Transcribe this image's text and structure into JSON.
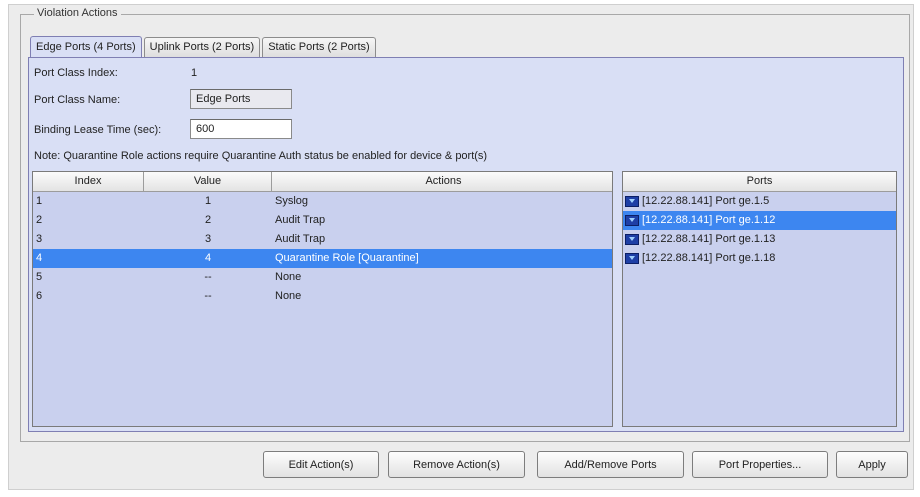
{
  "group_title": "Violation Actions",
  "tabs": [
    {
      "label": "Edge Ports (4 Ports)"
    },
    {
      "label": "Uplink Ports (2 Ports)"
    },
    {
      "label": "Static Ports (2 Ports)"
    }
  ],
  "form": {
    "index_label": "Port Class Index:",
    "index_value": "1",
    "name_label": "Port Class Name:",
    "name_value": "Edge Ports",
    "lease_label": "Binding Lease Time (sec):",
    "lease_value": "600",
    "note": "Note: Quarantine Role actions require Quarantine Auth status be enabled for device & port(s)"
  },
  "actions_table": {
    "headers": {
      "index": "Index",
      "value": "Value",
      "actions": "Actions"
    },
    "rows": [
      {
        "index": "1",
        "value": "1",
        "action": "Syslog"
      },
      {
        "index": "2",
        "value": "2",
        "action": "Audit Trap"
      },
      {
        "index": "3",
        "value": "3",
        "action": "Audit Trap"
      },
      {
        "index": "4",
        "value": "4",
        "action": "Quarantine Role [Quarantine]"
      },
      {
        "index": "5",
        "value": "--",
        "action": "None"
      },
      {
        "index": "6",
        "value": "--",
        "action": "None"
      }
    ]
  },
  "ports_table": {
    "header": "Ports",
    "rows": [
      {
        "label": "[12.22.88.141] Port ge.1.5",
        "icon": "port-icon"
      },
      {
        "label": "[12.22.88.141] Port ge.1.12",
        "icon": "port-icon"
      },
      {
        "label": "[12.22.88.141] Port ge.1.13",
        "icon": "port-icon"
      },
      {
        "label": "[12.22.88.141] Port ge.1.18",
        "icon": "port-icon"
      }
    ]
  },
  "buttons": {
    "edit": "Edit Action(s)",
    "remove": "Remove Action(s)",
    "add_remove_ports": "Add/Remove Ports",
    "port_properties": "Port Properties...",
    "apply": "Apply"
  },
  "colors": {
    "selection": "#3d86f0",
    "panel": "#d9dff5"
  }
}
